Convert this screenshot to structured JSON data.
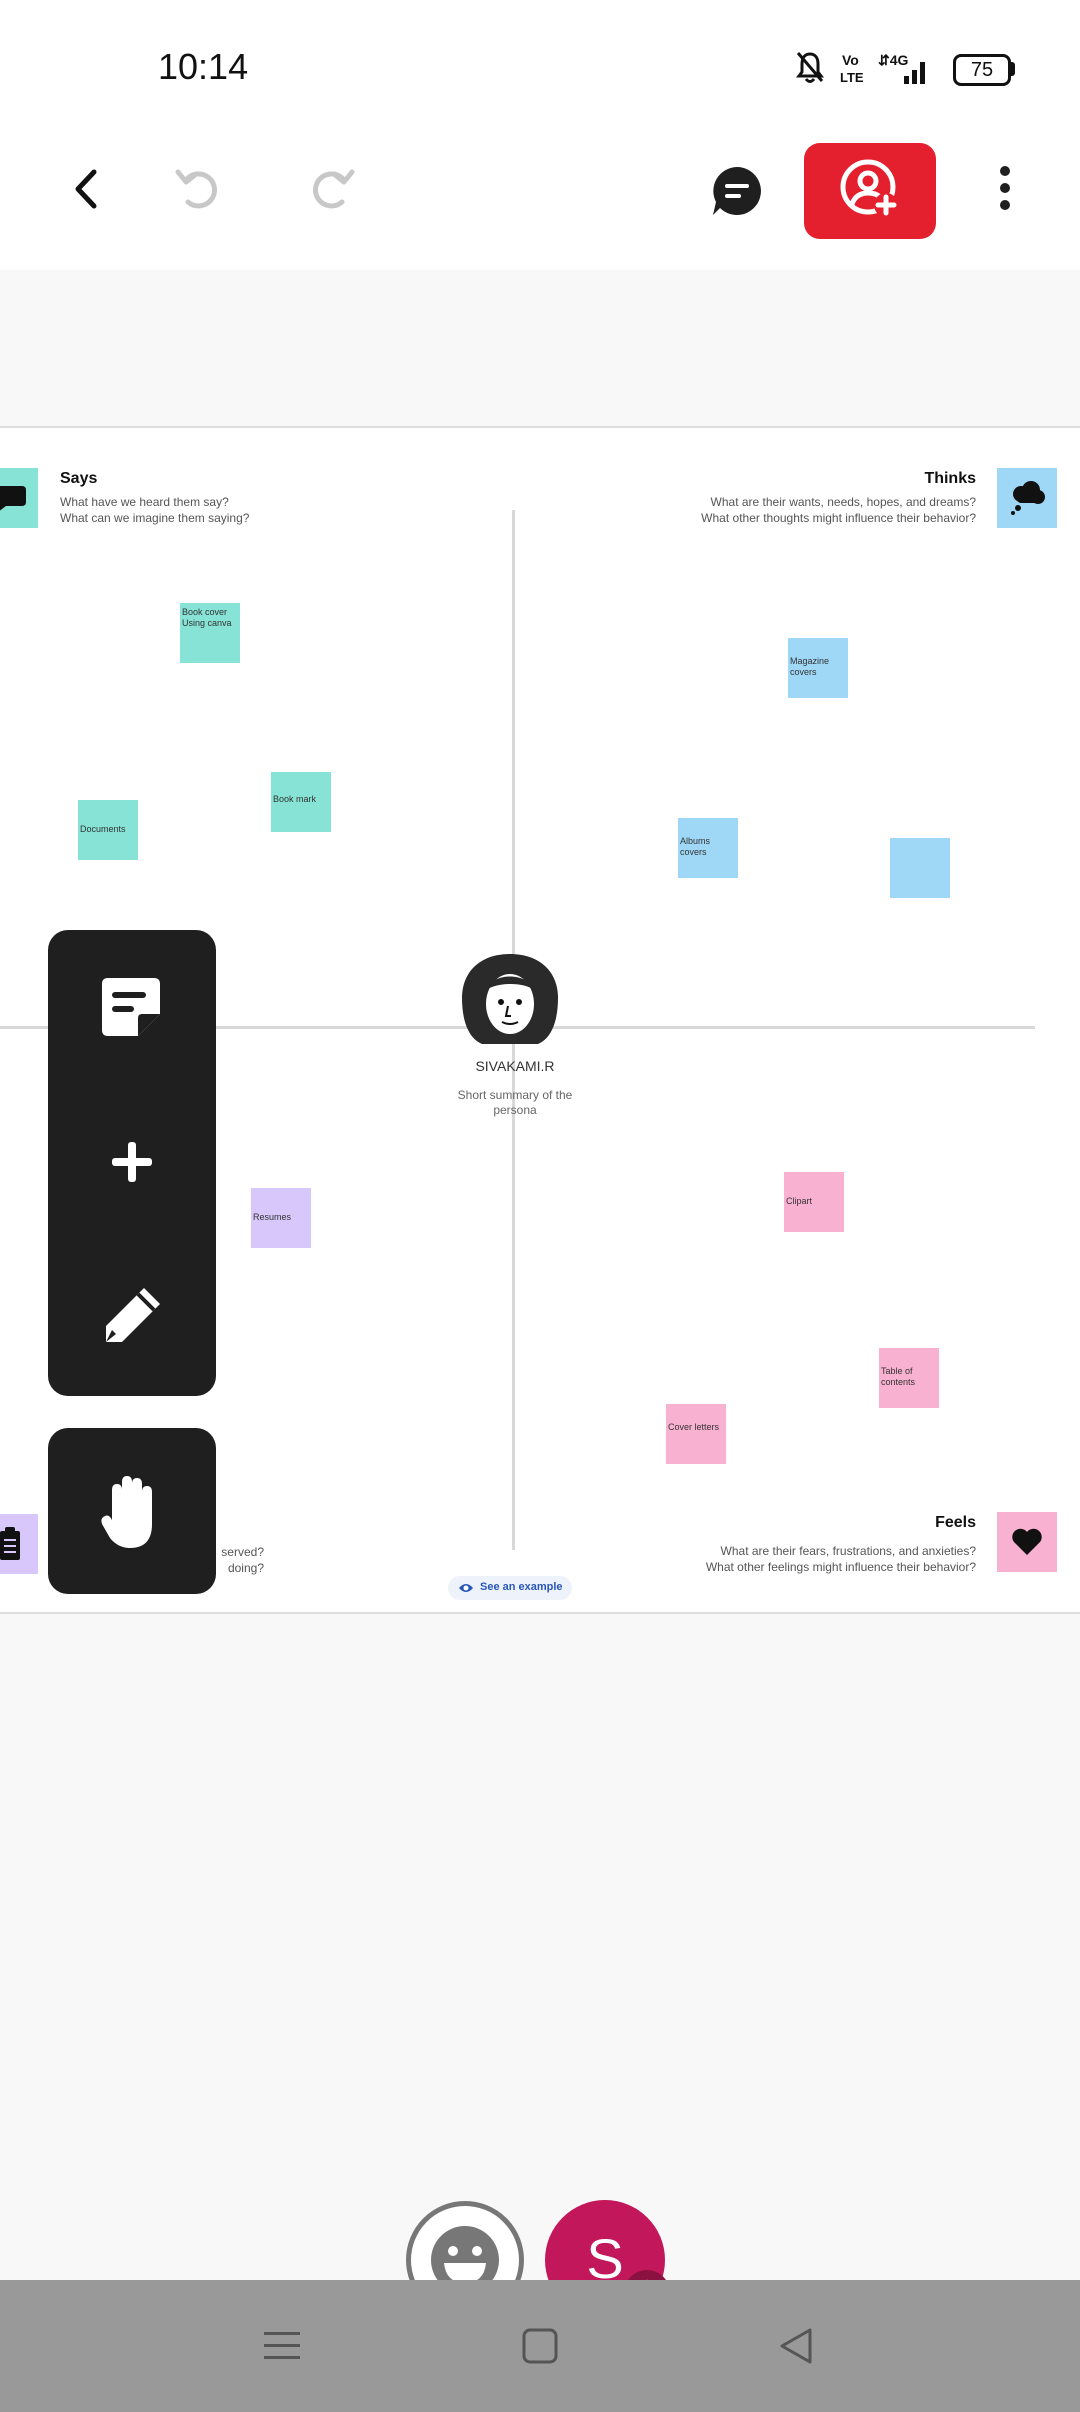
{
  "status_bar": {
    "time": "10:14",
    "battery": "75",
    "icons": [
      "bell-off-icon",
      "volte-icon",
      "4g-signal-icon",
      "battery-icon"
    ]
  },
  "toolbar": {
    "icons": [
      "back-icon",
      "undo-icon",
      "redo-icon",
      "comment-icon",
      "share-add-user-icon",
      "more-icon"
    ]
  },
  "board": {
    "quadrants": {
      "says": {
        "title": "Says",
        "sub1": "What have we heard them say?",
        "sub2": "What can we imagine them saying?"
      },
      "thinks": {
        "title": "Thinks",
        "sub1": "What are their wants, needs, hopes, and dreams?",
        "sub2": "What other thoughts might influence their behavior?"
      },
      "does": {
        "sub1": "served?",
        "sub2": "doing?"
      },
      "feels": {
        "title": "Feels",
        "sub1": "What are their fears, frustrations, and anxieties?",
        "sub2": "What other feelings might influence their behavior?"
      }
    },
    "persona": {
      "name": "SIVAKAMI.R",
      "summary": "Short summary of the persona"
    },
    "see_example": "See an example",
    "notes": {
      "book_cover": "Book cover Using canva",
      "documents": "Documents",
      "book_mark": "Book mark",
      "magazine": "Magazine covers",
      "albums": "Albums covers",
      "blank": "",
      "resumes": "Resumes",
      "clipart": "Clipart",
      "toc": "Table of contents",
      "cover_letters": "Cover letters"
    }
  },
  "tools": [
    "sticky-note-icon",
    "plus-icon",
    "pencil-icon",
    "hand-icon"
  ],
  "user": {
    "initial": "S"
  },
  "colors": {
    "share": "#e5202e",
    "avatar": "#c2185b",
    "teal": "#86e3d6",
    "blue": "#9fd8f7",
    "pink": "#f9b1d2",
    "purple": "#d7c7fb"
  }
}
